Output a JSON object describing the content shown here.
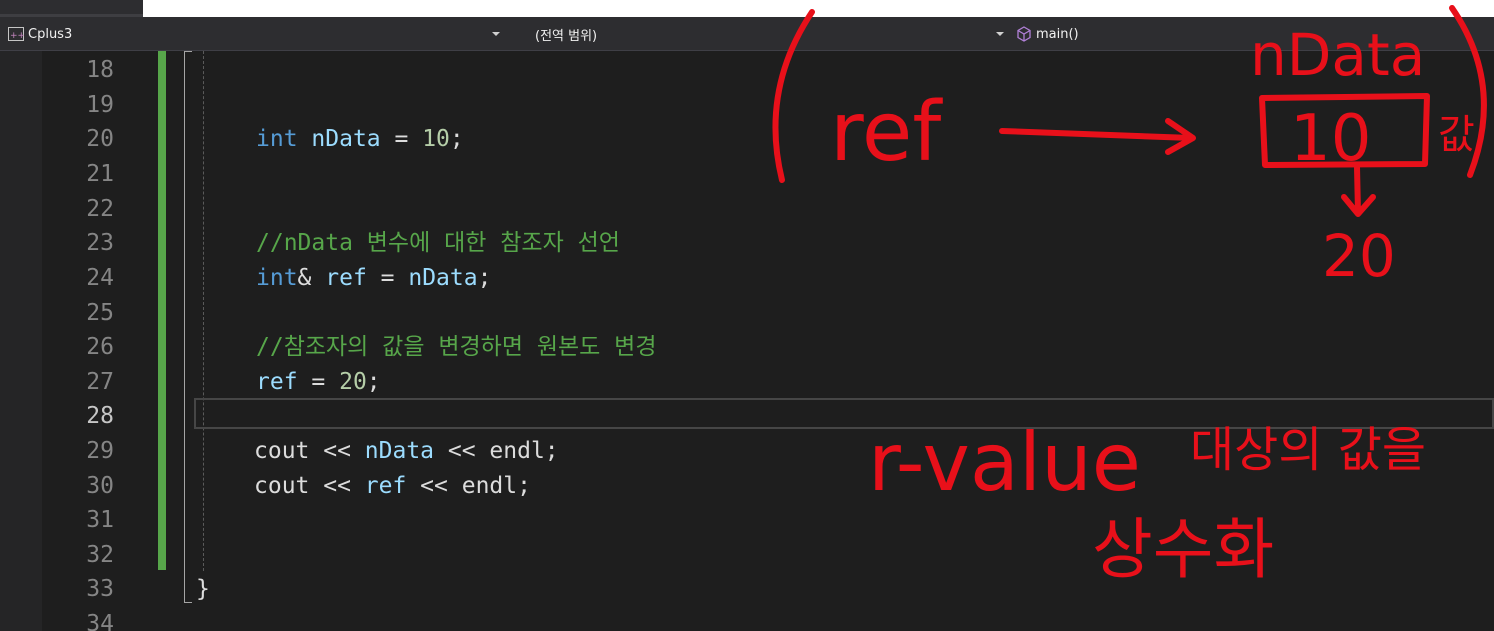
{
  "tabs": {
    "partial_tab_label": ""
  },
  "navbar": {
    "project": "Cplus3",
    "scope": "(전역 범위)",
    "function": "main()"
  },
  "editor": {
    "line_numbers": [
      "18",
      "19",
      "20",
      "21",
      "22",
      "23",
      "24",
      "25",
      "26",
      "27",
      "28",
      "29",
      "30",
      "31",
      "32",
      "33",
      "34"
    ],
    "current_line": "28",
    "lines": {
      "l20": {
        "kw": "int",
        "var": "nData",
        "op": " = ",
        "num": "10",
        "end": ";"
      },
      "l23": {
        "comment": "//nData 변수에 대한 참조자 선언"
      },
      "l24": {
        "kw": "int",
        "amp": "& ",
        "var1": "ref",
        "op": " = ",
        "var2": "nData",
        "end": ";"
      },
      "l26": {
        "comment": "//참조자의 값을 변경하면 원본도 변경"
      },
      "l27": {
        "var": "ref",
        "op": " = ",
        "num": "20",
        "end": ";"
      },
      "l29": {
        "a": "cout << ",
        "var": "nData",
        "b": " << endl;"
      },
      "l30": {
        "a": "cout << ",
        "var": "ref",
        "b": " << endl;"
      },
      "l33": {
        "brace": "}"
      }
    }
  },
  "annotations": {
    "ref_label": "ref",
    "ndata_label": "nData",
    "box_value": "10",
    "side_char": "값",
    "new_value": "20",
    "rvalue_text": "r-value",
    "korean_text_1": "대상의 값을",
    "korean_text_2": "상수화",
    "color": "#e8101a"
  },
  "colors": {
    "keyword": "#569cd6",
    "variable": "#9cdcfe",
    "number": "#b5cea8",
    "comment": "#57a64a",
    "change_bar": "#57a64a"
  }
}
